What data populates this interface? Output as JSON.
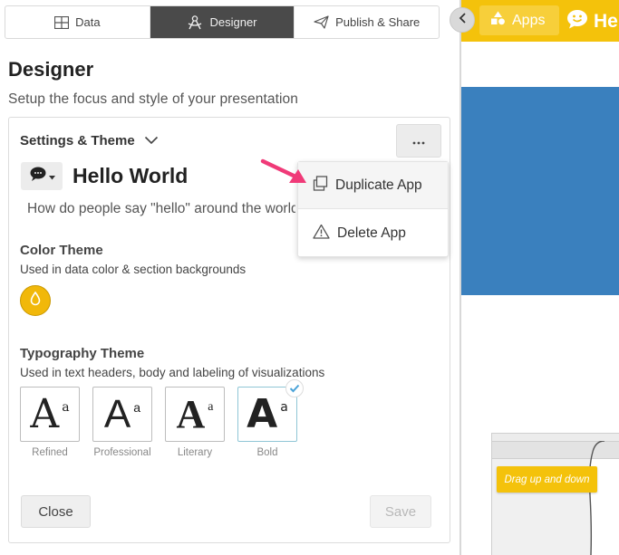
{
  "tabs": [
    {
      "label": "Data",
      "icon": "table-icon",
      "active": false
    },
    {
      "label": "Designer",
      "icon": "designer-icon",
      "active": true
    },
    {
      "label": "Publish & Share",
      "icon": "paper-plane-icon",
      "active": false
    }
  ],
  "page": {
    "heading": "Designer",
    "subheading": "Setup the focus and style of your presentation"
  },
  "settings": {
    "title": "Settings & Theme",
    "app_title": "Hello World",
    "app_description": "How do people say \"hello\" around the world?"
  },
  "menu": {
    "items": [
      {
        "label": "Duplicate App",
        "icon": "copy-icon"
      },
      {
        "label": "Delete App",
        "icon": "warning-icon"
      }
    ]
  },
  "color_theme": {
    "title": "Color Theme",
    "description": "Used in data color & section backgrounds",
    "swatch": "#f1b80a"
  },
  "typography_theme": {
    "title": "Typography Theme",
    "description": "Used in text headers, body and labeling of visualizations",
    "options": [
      {
        "label": "Refined",
        "big": "A",
        "small": "a",
        "selected": false
      },
      {
        "label": "Professional",
        "big": "A",
        "small": "a",
        "selected": false
      },
      {
        "label": "Literary",
        "big": "A",
        "small": "a",
        "selected": false
      },
      {
        "label": "Bold",
        "big": "A",
        "small": "a",
        "selected": true
      }
    ]
  },
  "buttons": {
    "close": "Close",
    "save": "Save"
  },
  "preview": {
    "apps_label": "Apps",
    "brand_label": "He",
    "tooltip": "Drag up and down"
  },
  "colors": {
    "accent": "#f4c20b",
    "preview_blue": "#3a80be",
    "arrow": "#f03a78"
  }
}
